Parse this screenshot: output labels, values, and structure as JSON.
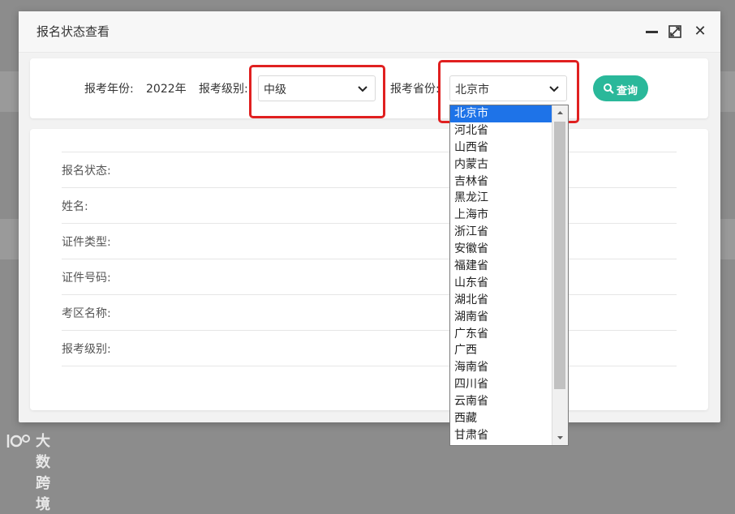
{
  "modal": {
    "title": "报名状态查看",
    "maximize_icon": "expand-icon",
    "close_glyph": "✕"
  },
  "filters": {
    "year_label": "报考年份:",
    "year_value": "2022年",
    "level_label": "报考级别:",
    "level_value": "中级",
    "province_label": "报考省份:",
    "province_value": "北京市",
    "query_label": "查询",
    "query_color": "#2ab89a",
    "highlight_color": "#e02020"
  },
  "details": {
    "rows": [
      "报名状态:",
      "姓名:",
      "证件类型:",
      "证件号码:",
      "考区名称:",
      "报考级别:"
    ]
  },
  "dropdown": {
    "options": [
      "北京市",
      "河北省",
      "山西省",
      "内蒙古",
      "吉林省",
      "黑龙江",
      "上海市",
      "浙江省",
      "安徽省",
      "福建省",
      "山东省",
      "湖北省",
      "湖南省",
      "广东省",
      "广西",
      "海南省",
      "四川省",
      "云南省",
      "西藏",
      "甘肃省"
    ],
    "selected_color": "#1e73e8"
  },
  "watermark": {
    "text": "大数跨境"
  }
}
